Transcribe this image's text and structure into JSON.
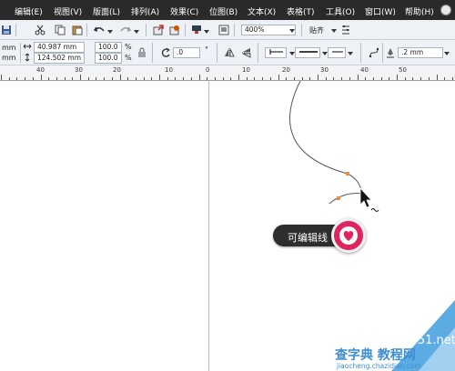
{
  "menu": {
    "items": [
      "编辑(E)",
      "视图(V)",
      "版面(L)",
      "排列(A)",
      "效果(C)",
      "位图(B)",
      "文本(X)",
      "表格(T)",
      "工具(O)",
      "窗口(W)",
      "帮助(H)"
    ]
  },
  "toolbar": {
    "zoom_value": "400%",
    "snap_label": "贴齐"
  },
  "property_bar": {
    "pos_x_unit": "mm",
    "pos_y_unit": "mm",
    "width_value": "40.987 mm",
    "height_value": "124.502 mm",
    "scale_w": "100.0",
    "scale_h": "100.0",
    "percent_1": "%",
    "percent_2": "%",
    "rotation_value": ".0",
    "degree_symbol": "°",
    "outline_width": ".2 mm"
  },
  "ruler": {
    "labels": [
      "40",
      "30",
      "20",
      "10",
      "0",
      "10",
      "20",
      "30",
      "40",
      "50"
    ]
  },
  "tooltip": {
    "text": "可编辑线"
  },
  "watermark": {
    "site": "jb51.net",
    "cn_main": "查字典 教程网",
    "url": "jiaocheng.chazidian.com"
  },
  "colors": {
    "menubar": "#2a2a2a",
    "toolbar_bg": "#eef1f5",
    "accent_pink": "#e0245e",
    "tooltip_bg": "#2e2e2e",
    "node_orange": "#f08a3c",
    "watermark_blue": "#3b93d6"
  }
}
